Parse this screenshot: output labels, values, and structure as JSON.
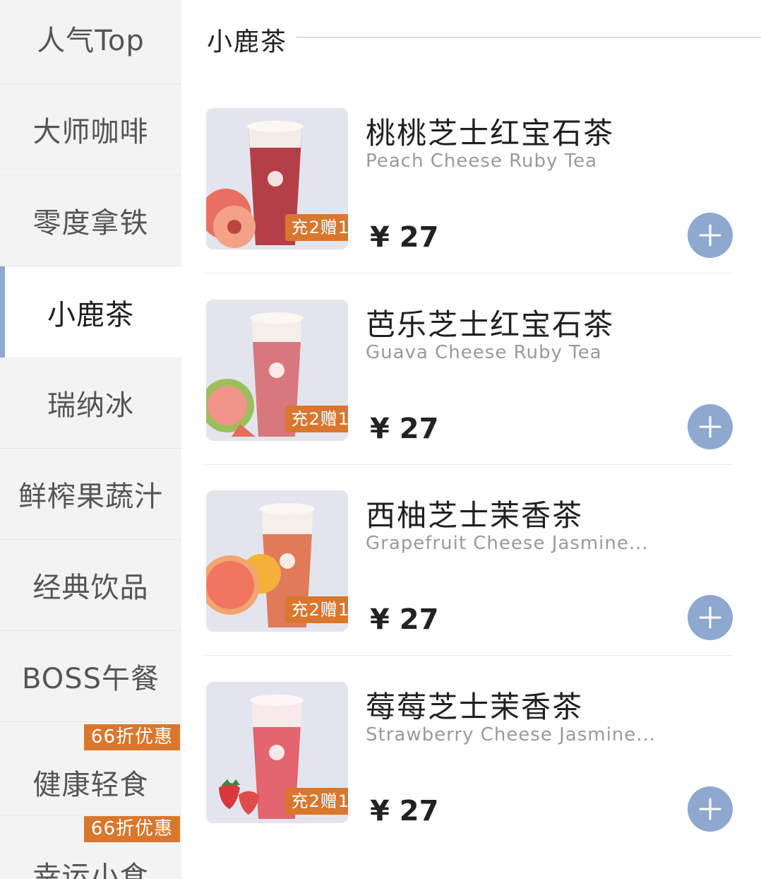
{
  "sidebar": {
    "items": [
      {
        "label": "人气Top",
        "promo": ""
      },
      {
        "label": "大师咖啡",
        "promo": ""
      },
      {
        "label": "零度拿铁",
        "promo": ""
      },
      {
        "label": "小鹿茶",
        "promo": "",
        "active": true
      },
      {
        "label": "瑞纳冰",
        "promo": ""
      },
      {
        "label": "鲜榨果蔬汁",
        "promo": ""
      },
      {
        "label": "经典饮品",
        "promo": ""
      },
      {
        "label": "BOSS午餐",
        "promo": ""
      },
      {
        "label": "健康轻食",
        "promo": "66折优惠"
      },
      {
        "label": "幸运小食",
        "promo": "66折优惠"
      }
    ]
  },
  "section": {
    "title": "小鹿茶"
  },
  "products": [
    {
      "name_cn": "桃桃芝士红宝石茶",
      "name_en": "Peach Cheese Ruby Tea",
      "price": "¥ 27",
      "promo": "充2赠1",
      "fruit": "peach-icon",
      "cup_color": "#b34048"
    },
    {
      "name_cn": "芭乐芝士红宝石茶",
      "name_en": "Guava Cheese Ruby Tea",
      "price": "¥ 27",
      "promo": "充2赠1",
      "fruit": "guava-icon",
      "cup_color": "#d9787c"
    },
    {
      "name_cn": "西柚芝士茉香茶",
      "name_en": "Grapefruit Cheese Jasmine...",
      "price": "¥ 27",
      "promo": "充2赠1",
      "fruit": "grapefruit-icon",
      "cup_color": "#e07a58"
    },
    {
      "name_cn": "莓莓芝士茉香茶",
      "name_en": "Strawberry Cheese Jasmine...",
      "price": "¥ 27",
      "promo": "充2赠1",
      "fruit": "strawberry-icon",
      "cup_color": "#e2656f"
    }
  ],
  "colors": {
    "accent": "#8ea8cf",
    "promo": "#d9772e",
    "sidebar_bg": "#f3f3f3"
  }
}
